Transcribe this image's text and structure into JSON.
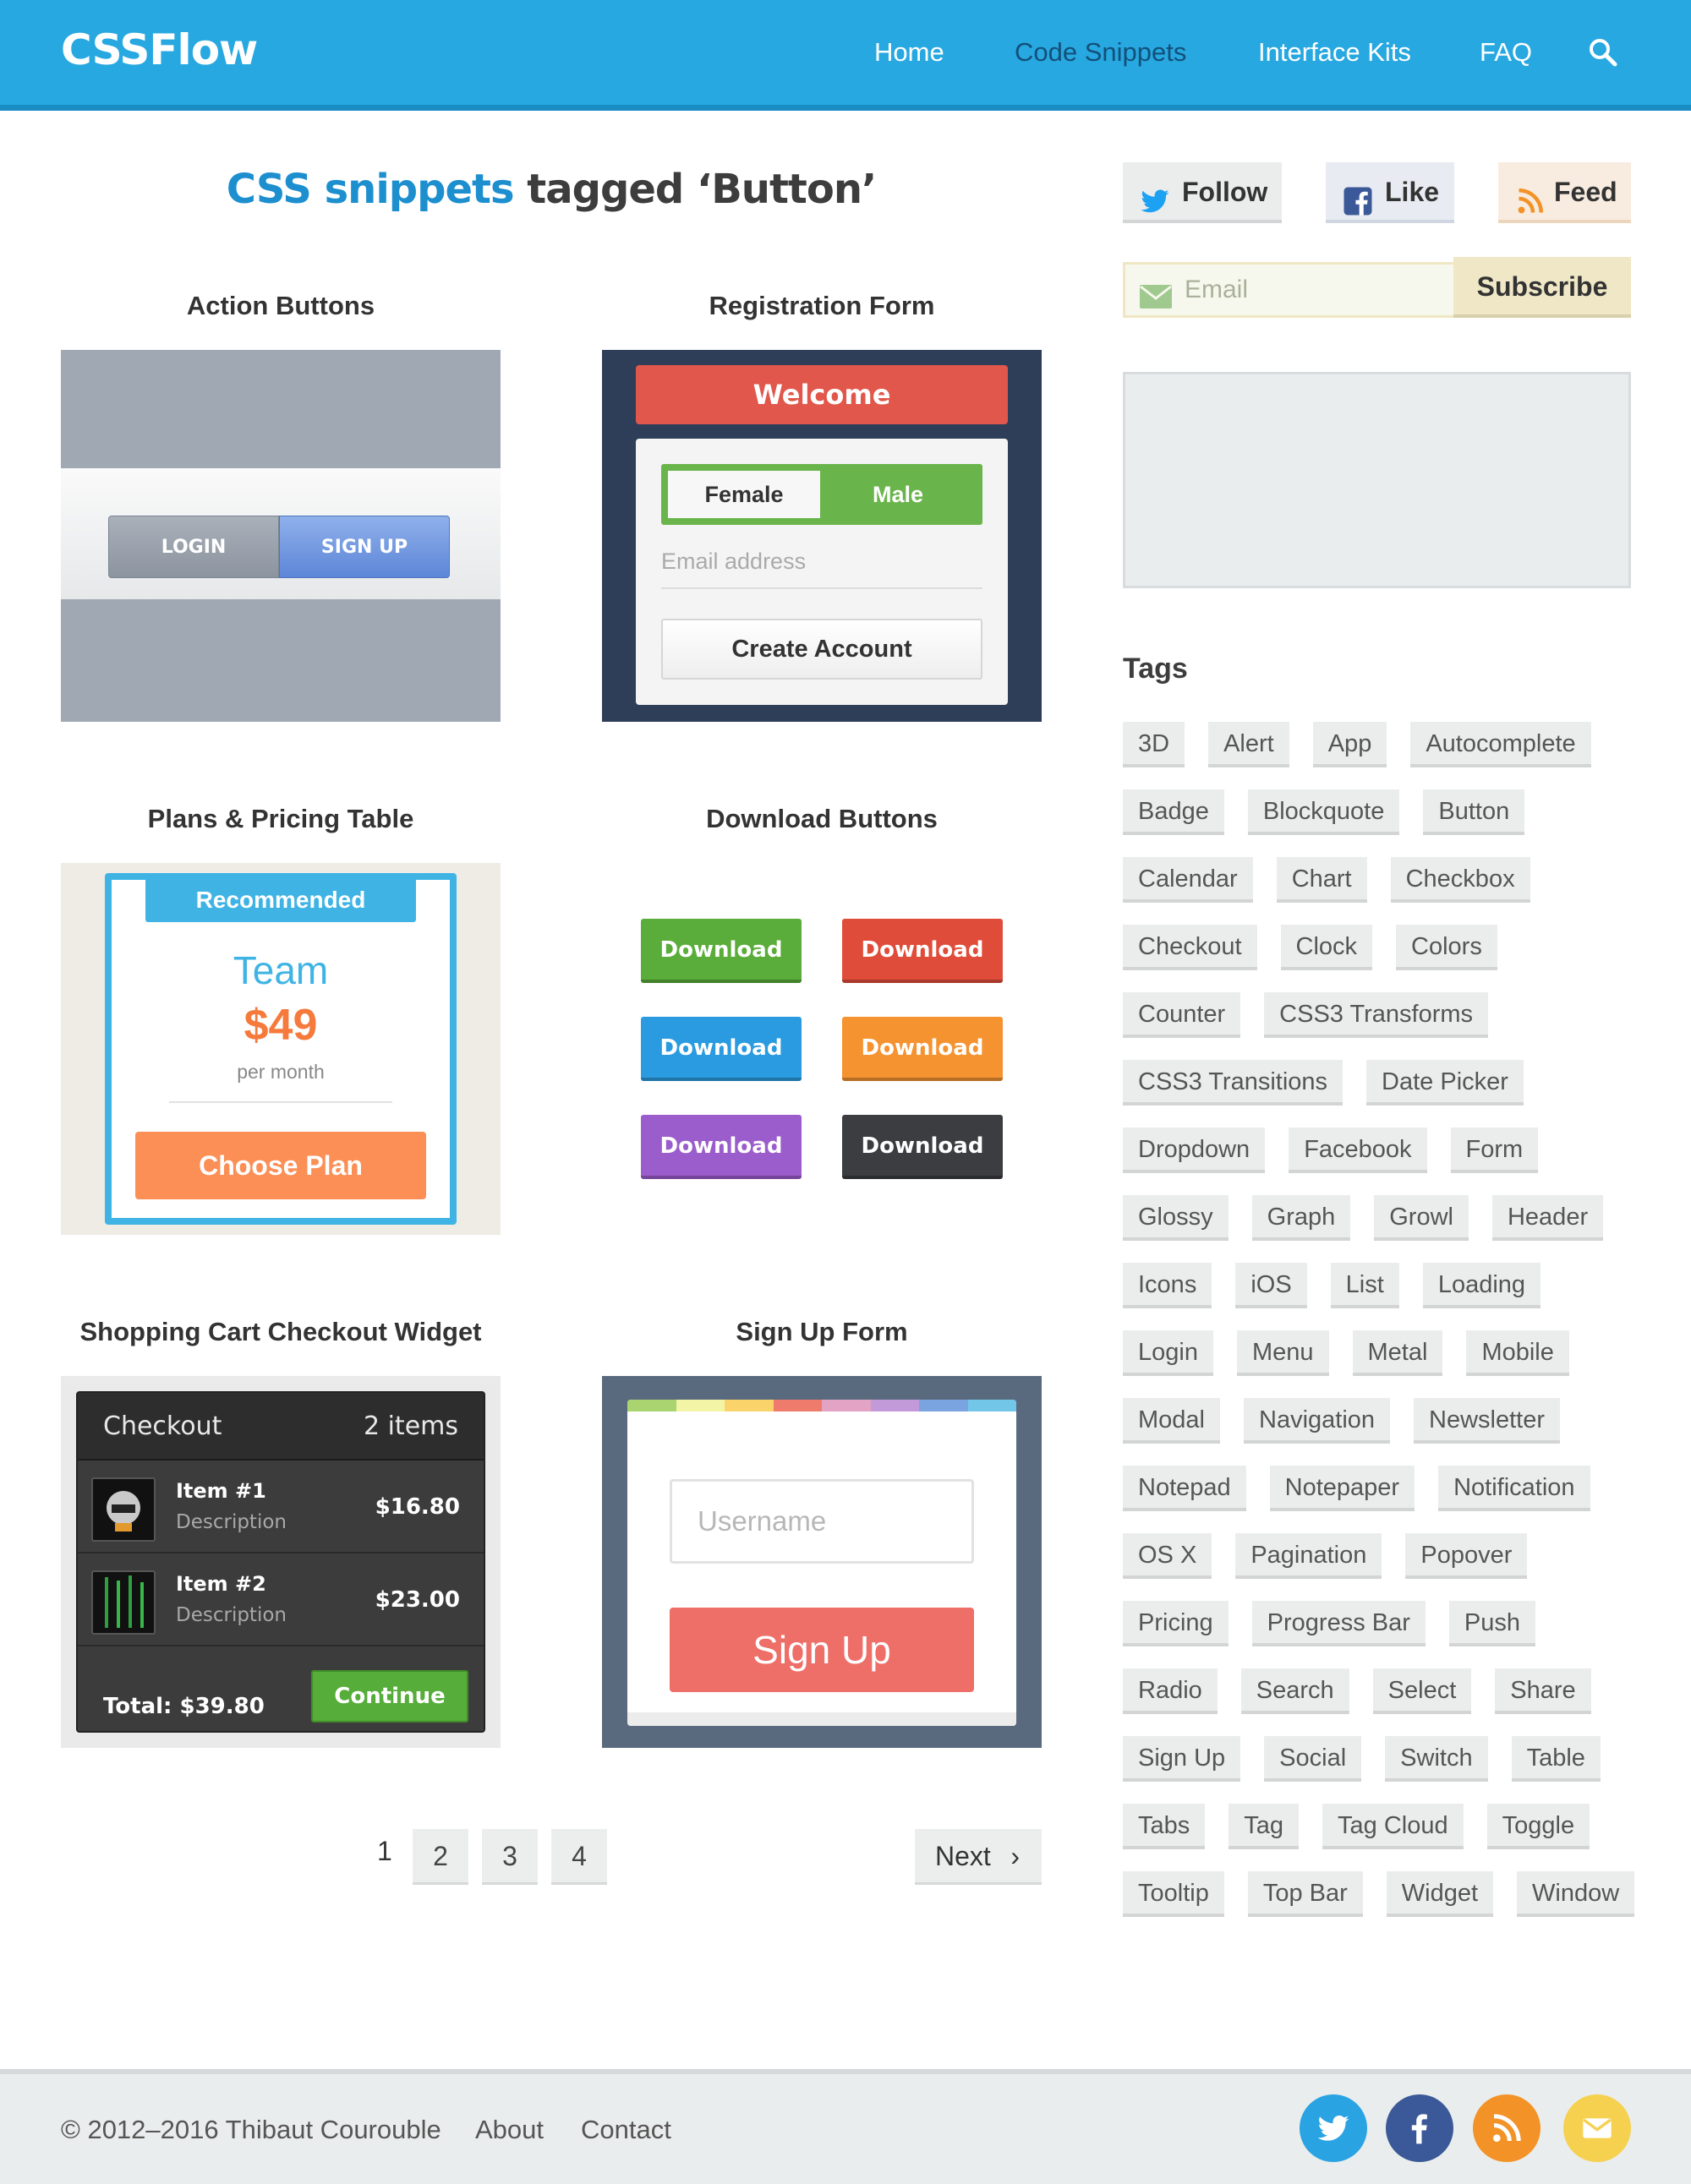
{
  "header": {
    "logo": "CSSFlow",
    "nav": [
      "Home",
      "Code Snippets",
      "Interface Kits",
      "FAQ"
    ],
    "active_nav": "Code Snippets"
  },
  "main": {
    "heading_highlight": "CSS snippets",
    "heading_rest": "tagged ‘Button’",
    "snippets": [
      {
        "title": "Action Buttons"
      },
      {
        "title": "Registration Form"
      },
      {
        "title": "Plans & Pricing Table"
      },
      {
        "title": "Download Buttons"
      },
      {
        "title": "Shopping Cart Checkout Widget"
      },
      {
        "title": "Sign Up Form"
      }
    ],
    "action_buttons": {
      "login": "LOGIN",
      "signup": "SIGN UP"
    },
    "registration": {
      "welcome": "Welcome",
      "female": "Female",
      "male": "Male",
      "email_placeholder": "Email address",
      "create": "Create Account"
    },
    "pricing": {
      "badge": "Recommended",
      "plan": "Team",
      "price": "$49",
      "period": "per month",
      "cta": "Choose Plan"
    },
    "download": {
      "label": "Download",
      "colors": [
        "#5aad3a",
        "#e04c3a",
        "#2a9be0",
        "#f59331",
        "#9b5ccc",
        "#3b3d40"
      ]
    },
    "checkout": {
      "title": "Checkout",
      "count": "2 items",
      "items": [
        {
          "name": "Item #1",
          "desc": "Description",
          "price": "$16.80"
        },
        {
          "name": "Item #2",
          "desc": "Description",
          "price": "$23.00"
        }
      ],
      "total": "Total: $39.80",
      "cta": "Continue"
    },
    "signup": {
      "username_placeholder": "Username",
      "button": "Sign Up",
      "stripe_colors": [
        "#a9d46f",
        "#f3f4a6",
        "#fbd36b",
        "#ee7b6b",
        "#e2a3c4",
        "#c39ad9",
        "#7aa4e0",
        "#72c6e8"
      ]
    },
    "pagination": {
      "current": "1",
      "pages": [
        "2",
        "3",
        "4"
      ],
      "next": "Next"
    }
  },
  "sidebar": {
    "follow": "Follow",
    "like": "Like",
    "feed": "Feed",
    "email_placeholder": "Email",
    "subscribe": "Subscribe",
    "tags_title": "Tags",
    "tags": [
      "3D",
      "Alert",
      "App",
      "Autocomplete",
      "Badge",
      "Blockquote",
      "Button",
      "Calendar",
      "Chart",
      "Checkbox",
      "Checkout",
      "Clock",
      "Colors",
      "Counter",
      "CSS3 Transforms",
      "CSS3 Transitions",
      "Date Picker",
      "Dropdown",
      "Facebook",
      "Form",
      "Glossy",
      "Graph",
      "Growl",
      "Header",
      "Icons",
      "iOS",
      "List",
      "Loading",
      "Login",
      "Menu",
      "Metal",
      "Mobile",
      "Modal",
      "Navigation",
      "Newsletter",
      "Notepad",
      "Notepaper",
      "Notification",
      "OS X",
      "Pagination",
      "Popover",
      "Pricing",
      "Progress Bar",
      "Push",
      "Radio",
      "Search",
      "Select",
      "Share",
      "Sign Up",
      "Social",
      "Switch",
      "Table",
      "Tabs",
      "Tag",
      "Tag Cloud",
      "Toggle",
      "Tooltip",
      "Top Bar",
      "Widget",
      "Window"
    ]
  },
  "footer": {
    "copyright": "© 2012–2016 Thibaut Courouble",
    "about": "About",
    "contact": "Contact",
    "social_colors": [
      "#2aa3e3",
      "#3b5998",
      "#f39226",
      "#f5d14f"
    ]
  }
}
